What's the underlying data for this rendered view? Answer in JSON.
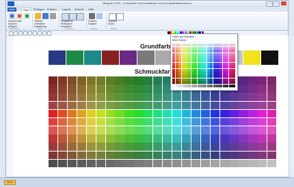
{
  "window": {
    "title": "Minigram 2024 - Farbpalette Schmuckfarben.mmf (Kompatibilitätsmodus)"
  },
  "tabs": [
    "Datei",
    "Start",
    "Einfügen",
    "Entwurf",
    "Layout",
    "Ansicht",
    "Hilfe"
  ],
  "ribbon": {
    "groups": [
      {
        "label": "Bearbeiten",
        "items": [
          "Ausschneiden",
          "Kopieren",
          "Einfügen"
        ]
      },
      {
        "label": "Farbe",
        "items": [
          "Füllfarbe",
          "Linienfarbe",
          "Schattierung"
        ]
      },
      {
        "label": "Anordnen",
        "items": [
          "Vordergrund",
          "Hintergrund",
          "Gruppieren"
        ]
      },
      {
        "label": "Effekte",
        "items": [
          "Schatten",
          "Spiegeln"
        ]
      },
      {
        "label": "Schrift",
        "items": [
          "Schriftart",
          "Größe"
        ]
      }
    ]
  },
  "page": {
    "heading1": "Grundfarb",
    "heading2": "Schmuckfar"
  },
  "popup": {
    "title": "Mehr Farben",
    "default_item": "Farbe aus Standard"
  },
  "status": {
    "badge": "Bereit"
  },
  "colors": {
    "base_strip": [
      "#283a84",
      "#1e8a46",
      "#1d8a8a",
      "#8a2121",
      "#6a2a86",
      "#7a7a7a",
      "#aaaaaa",
      "#2040b0",
      "#d81e1e",
      "#e06ab0",
      "#c4c4c4",
      "#f0e21e",
      "#111111"
    ]
  }
}
